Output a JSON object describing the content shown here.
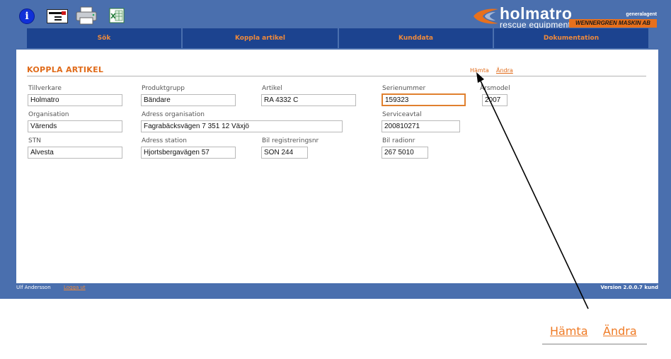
{
  "logo": {
    "word": "holmatro",
    "tagline": "rescue equipment",
    "generalagent": "generalagent",
    "dealer": "WENNERGREN MASKIN AB"
  },
  "toolbar": {
    "icons": [
      "info-icon",
      "card-icon",
      "printer-icon",
      "excel-icon"
    ]
  },
  "nav": {
    "tabs": [
      "Sök",
      "Koppla artikel",
      "Kunddata",
      "Dokumentation"
    ]
  },
  "section": {
    "title": "KOPPLA ARTIKEL",
    "hamta": "Hämta",
    "andra": "Ändra"
  },
  "form": {
    "tillverkare": {
      "label": "Tillverkare",
      "value": "Holmatro"
    },
    "produktgrupp": {
      "label": "Produktgrupp",
      "value": "Bändare"
    },
    "artikel": {
      "label": "Artikel",
      "value": "RA 4332 C"
    },
    "serienummer": {
      "label": "Serienummer",
      "value": "159323"
    },
    "arsmodel": {
      "label": "Årsmodel",
      "value": "2007"
    },
    "organisation": {
      "label": "Organisation",
      "value": "Värends"
    },
    "adress_organisation": {
      "label": "Adress organisation",
      "value": "Fagrabäcksvägen 7  351 12 Växjö"
    },
    "serviceavtal": {
      "label": "Serviceavtal",
      "value": "200810271"
    },
    "stn": {
      "label": "STN",
      "value": "Alvesta"
    },
    "adress_station": {
      "label": "Adress station",
      "value": "Hjortsbergavägen 57"
    },
    "bil_registreringsnr": {
      "label": "Bil registreringsnr",
      "value": "SON 244"
    },
    "bil_radionr": {
      "label": "Bil radionr",
      "value": "267 5010"
    }
  },
  "footer": {
    "user": "Ulf Andersson",
    "logout": "Logga ut",
    "version": "Version 2.0.0.7 kund"
  },
  "zoom": {
    "hamta": "Hämta",
    "andra": "Ändra"
  },
  "colors": {
    "frame": "#4a6fae",
    "nav": "#1c438f",
    "accent": "#e06b1a"
  }
}
